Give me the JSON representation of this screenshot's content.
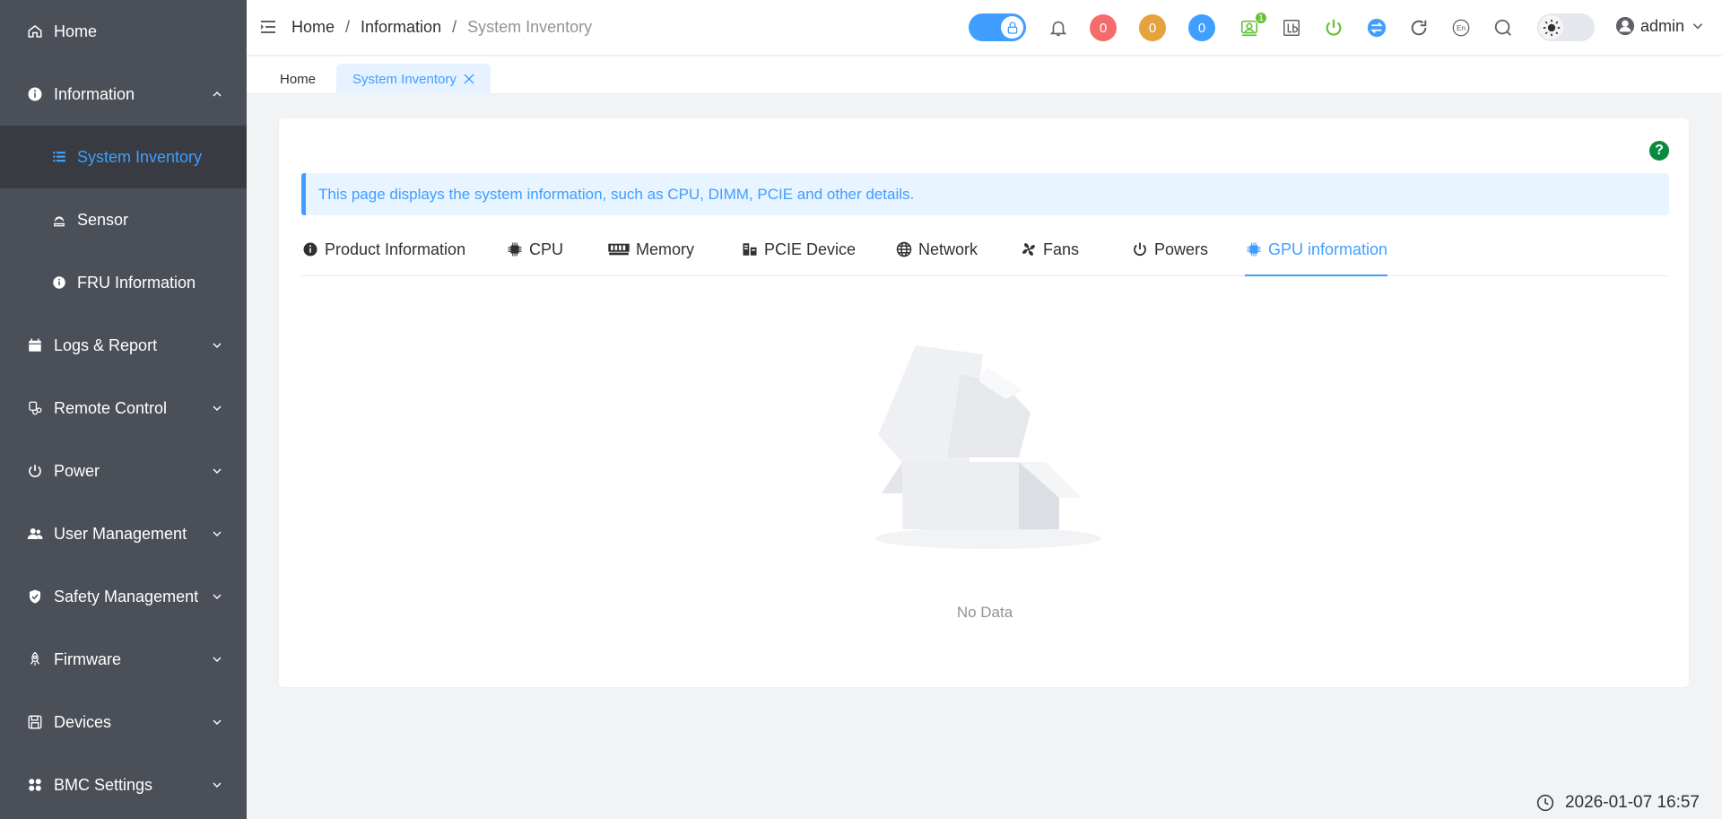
{
  "sidebar": {
    "items": [
      {
        "label": "Home",
        "icon": "home-icon"
      },
      {
        "label": "Information",
        "icon": "info-icon",
        "expanded": true,
        "children": [
          {
            "label": "System Inventory",
            "icon": "list-icon",
            "active": true
          },
          {
            "label": "Sensor",
            "icon": "sensor-icon"
          },
          {
            "label": "FRU Information",
            "icon": "info-icon"
          }
        ]
      },
      {
        "label": "Logs & Report",
        "icon": "calendar-icon"
      },
      {
        "label": "Remote Control",
        "icon": "remote-icon"
      },
      {
        "label": "Power",
        "icon": "power-icon"
      },
      {
        "label": "User Management",
        "icon": "users-icon"
      },
      {
        "label": "Safety Management",
        "icon": "shield-icon"
      },
      {
        "label": "Firmware",
        "icon": "rocket-icon"
      },
      {
        "label": "Devices",
        "icon": "save-icon"
      },
      {
        "label": "BMC Settings",
        "icon": "grid-icon"
      }
    ]
  },
  "header": {
    "breadcrumb": [
      "Home",
      "Information",
      "System Inventory"
    ],
    "badges": {
      "red": "0",
      "orange": "0",
      "blue": "0"
    },
    "user_badge": "1",
    "lang": "En",
    "username": "admin"
  },
  "tags": {
    "home": "Home",
    "active": "System Inventory"
  },
  "content": {
    "alert": "This page displays the system information, such as CPU, DIMM, PCIE and other details.",
    "help": "?",
    "tabs": [
      {
        "label": "Product Information",
        "icon": "info-icon"
      },
      {
        "label": "CPU",
        "icon": "cpu-icon"
      },
      {
        "label": "Memory",
        "icon": "memory-icon"
      },
      {
        "label": "PCIE Device",
        "icon": "pcie-icon"
      },
      {
        "label": "Network",
        "icon": "globe-icon"
      },
      {
        "label": "Fans",
        "icon": "fan-icon"
      },
      {
        "label": "Powers",
        "icon": "power-icon"
      },
      {
        "label": "GPU information",
        "icon": "gpu-icon",
        "active": true
      }
    ],
    "empty_text": "No Data"
  },
  "footer": {
    "datetime": "2026-01-07 16:57"
  },
  "colors": {
    "accent": "#409eff",
    "sidebar": "#4b4f57",
    "red": "#f56c6c",
    "orange": "#e6a23c",
    "blue": "#409eff",
    "green": "#67c23a"
  }
}
